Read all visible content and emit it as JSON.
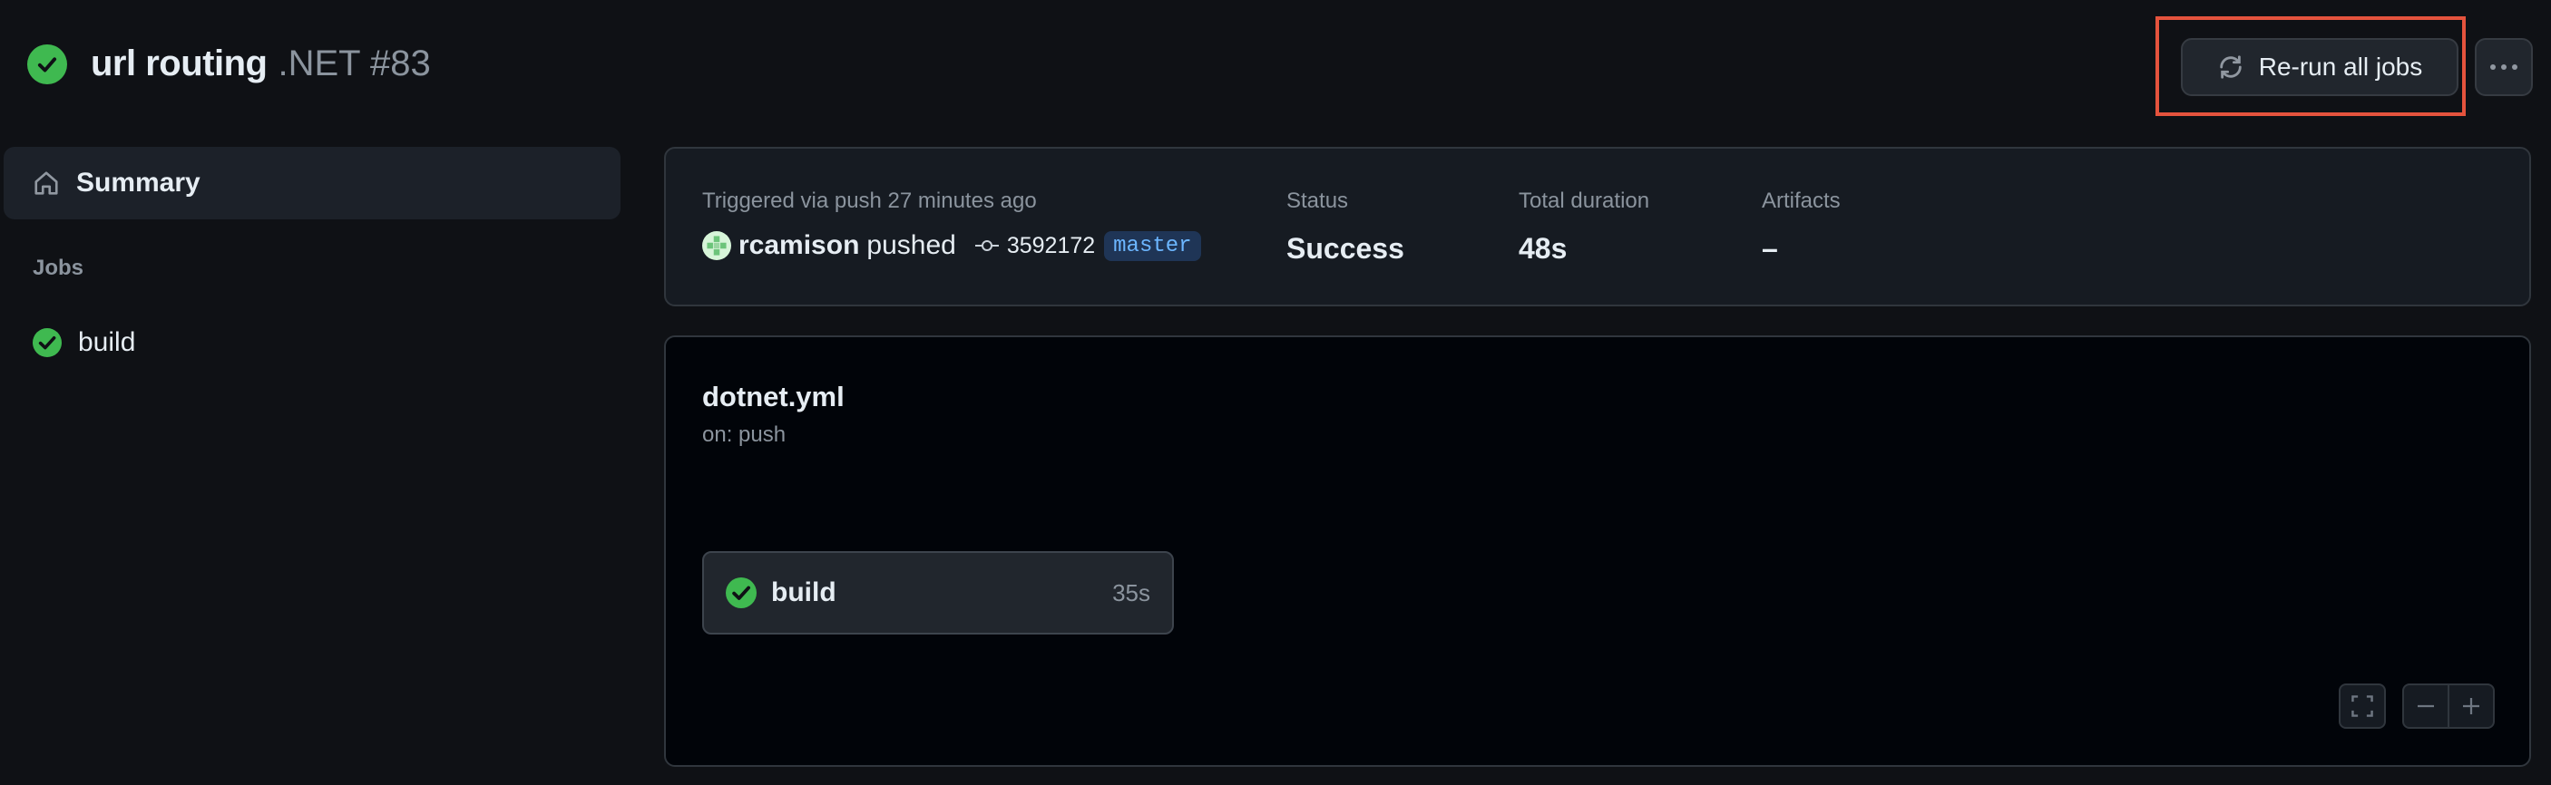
{
  "header": {
    "status_icon": "check-circle-icon",
    "status_color": "#3fb950",
    "workflow_run_name": "url routing",
    "workflow_name_number": ".NET #83",
    "rerun_label": "Re-run all jobs",
    "rerun_icon": "sync-icon",
    "more_icon": "kebab-horizontal-icon"
  },
  "sidebar": {
    "summary_label": "Summary",
    "summary_icon": "home-icon",
    "jobs_heading": "Jobs",
    "jobs": [
      {
        "label": "build",
        "icon": "check-circle-icon"
      }
    ]
  },
  "info": {
    "trigger_label": "Triggered via push 27 minutes ago",
    "actor": "rcamison",
    "action": "pushed",
    "commit_icon": "git-commit-icon",
    "commit": "3592172",
    "branch": "master",
    "status_label": "Status",
    "status_value": "Success",
    "duration_label": "Total duration",
    "duration_value": "48s",
    "artifacts_label": "Artifacts",
    "artifacts_value": "–"
  },
  "graph": {
    "workflow_file": "dotnet.yml",
    "on_event": "on: push",
    "job": {
      "name": "build",
      "duration": "35s",
      "icon": "check-circle-icon"
    },
    "controls": [
      "fullscreen-icon",
      "zoom-out-icon",
      "zoom-in-icon"
    ]
  },
  "colors": {
    "background": "#0f1115",
    "success": "#3fb950",
    "highlight_outline": "#e5533d",
    "branch_text": "#6cb6ff"
  }
}
